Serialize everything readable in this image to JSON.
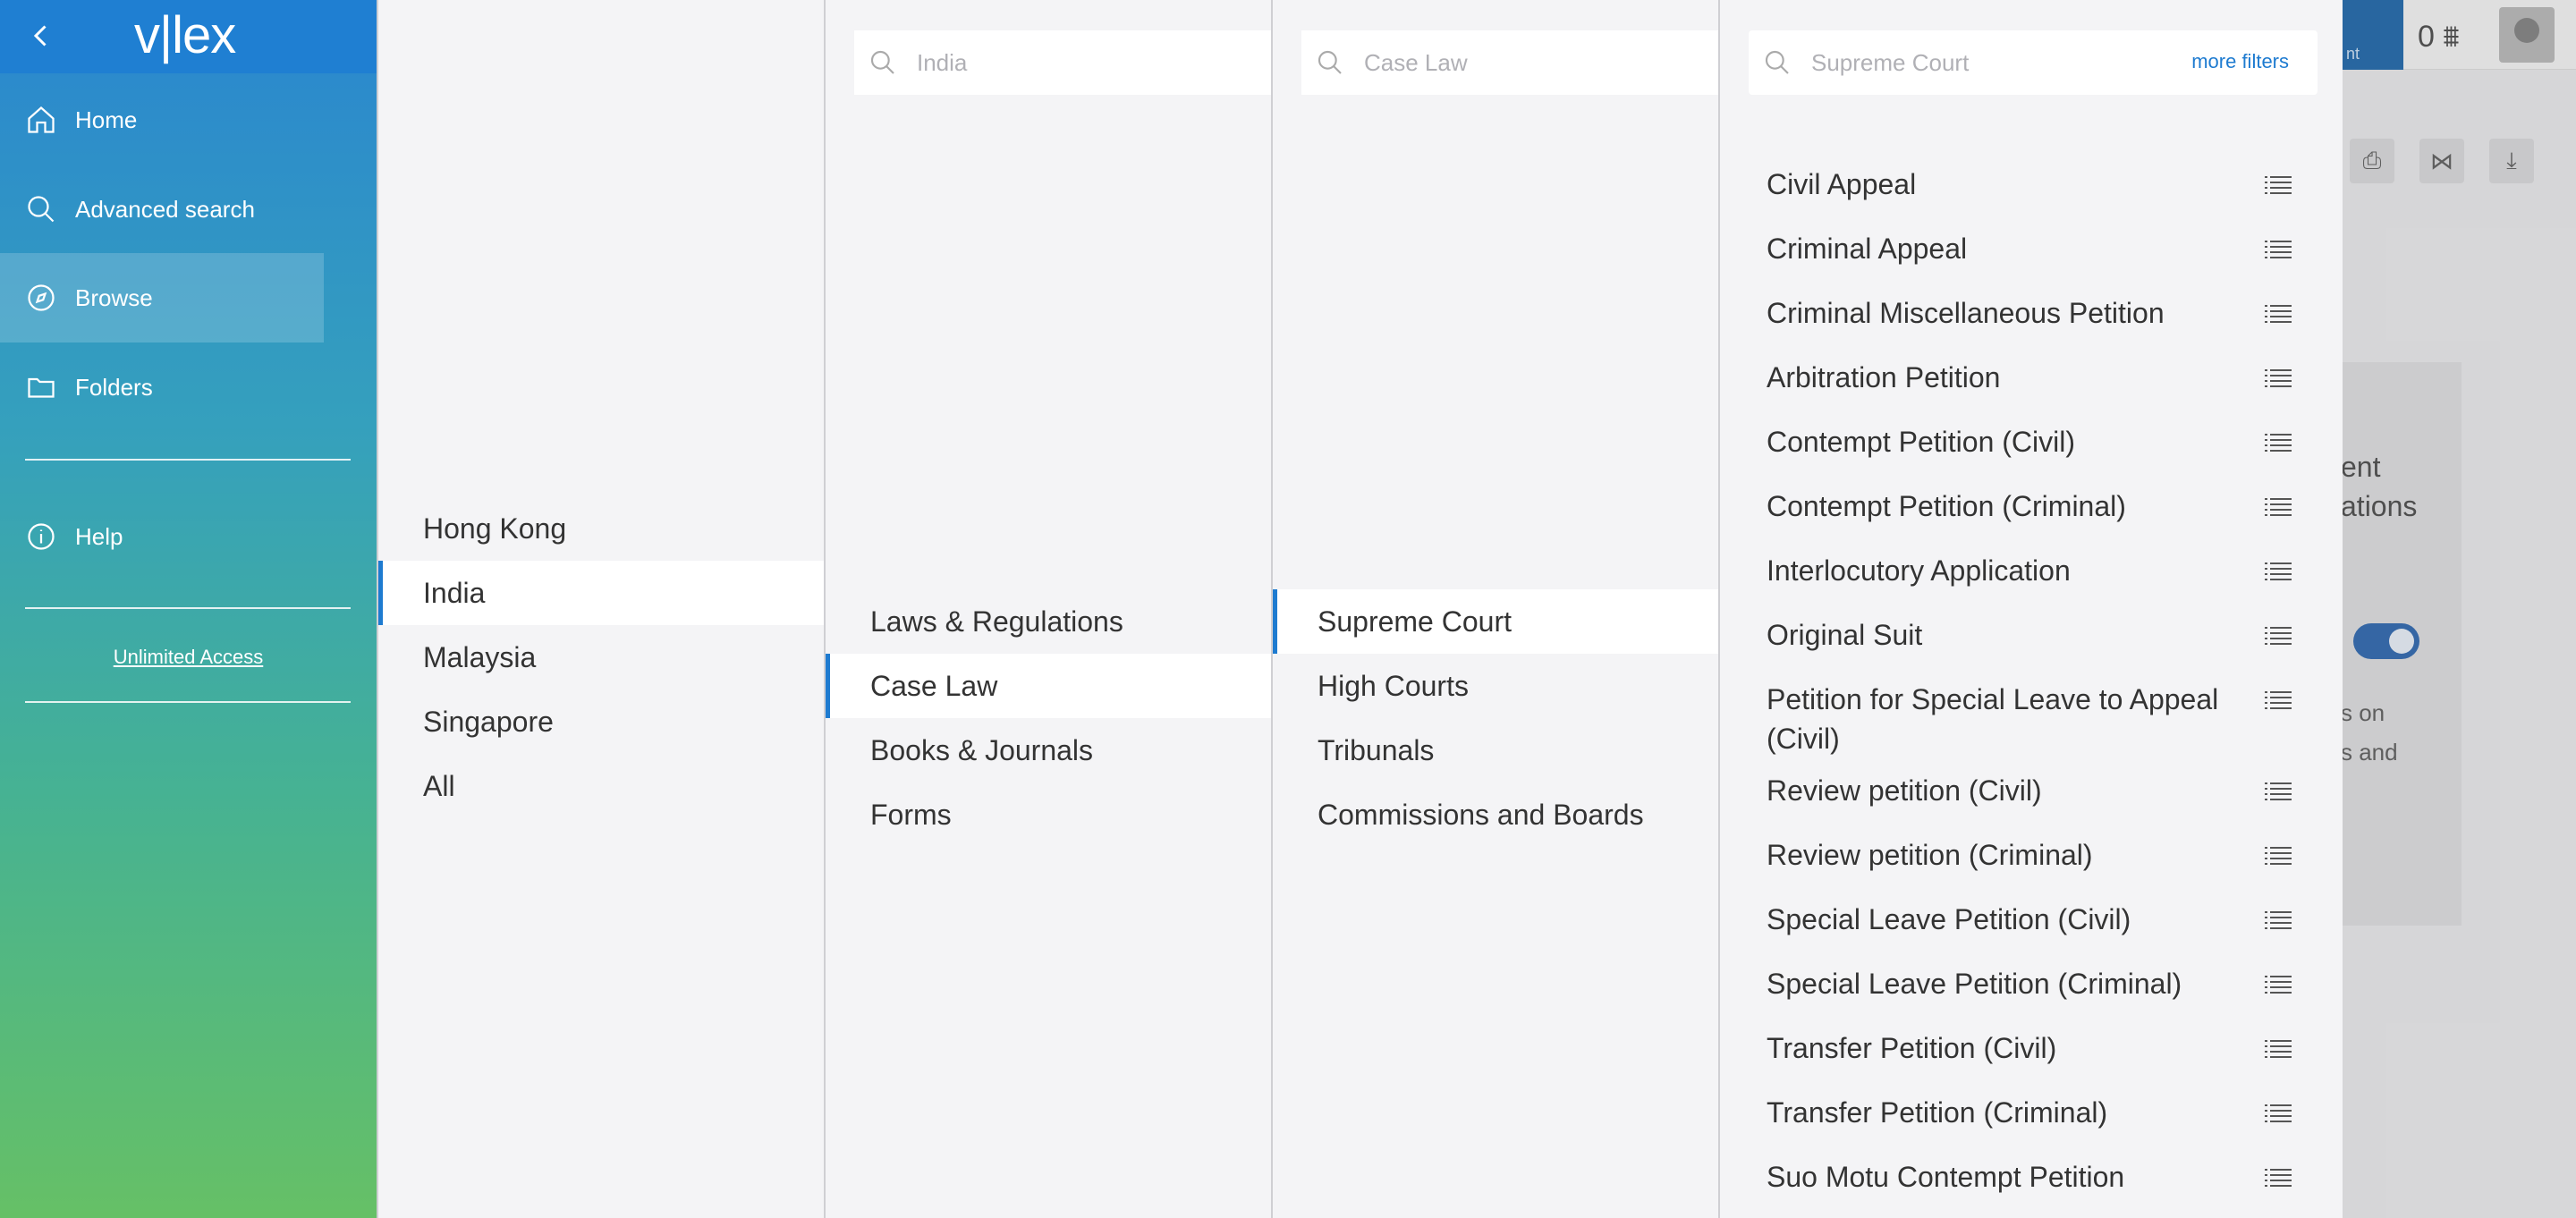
{
  "sidebar": {
    "logo": "v|lex",
    "items": [
      {
        "label": "Home",
        "icon": "home-icon"
      },
      {
        "label": "Advanced search",
        "icon": "search-icon"
      },
      {
        "label": "Browse",
        "icon": "compass-icon"
      },
      {
        "label": "Folders",
        "icon": "folder-icon"
      },
      {
        "label": "Help",
        "icon": "info-icon"
      }
    ],
    "unlimited_access": "Unlimited Access",
    "accent": "#1f7fd2"
  },
  "columns": {
    "jurisdictions": {
      "items": [
        "Hong Kong",
        "India",
        "Malaysia",
        "Singapore",
        "All"
      ],
      "selected": "India"
    },
    "content_types": {
      "search_placeholder": "India",
      "items": [
        "Laws & Regulations",
        "Case Law",
        "Books & Journals",
        "Forms"
      ],
      "selected": "Case Law"
    },
    "courts": {
      "search_placeholder": "Case Law",
      "items": [
        "Supreme Court",
        "High Courts",
        "Tribunals",
        "Commissions and Boards"
      ],
      "selected": "Supreme Court"
    },
    "case_types": {
      "search_placeholder": "Supreme Court",
      "more_filters": "more filters",
      "items": [
        "Civil Appeal",
        "Criminal Appeal",
        "Criminal Miscellaneous Petition",
        "Arbitration Petition",
        "Contempt Petition (Civil)",
        "Contempt Petition (Criminal)",
        "Interlocutory Application",
        "Original Suit",
        "Petition for Special Leave to Appeal (Civil)",
        "Review petition (Civil)",
        "Review petition (Criminal)",
        "Special Leave Petition (Civil)",
        "Special Leave Petition (Criminal)",
        "Transfer Petition (Civil)",
        "Transfer Petition (Criminal)",
        "Suo Motu Contempt Petition"
      ]
    }
  },
  "background": {
    "topbar_label": "nt",
    "credits": "0 ⩩",
    "card_text": [
      "ent",
      "ations"
    ],
    "card_text2": [
      "s on",
      "s and"
    ]
  }
}
